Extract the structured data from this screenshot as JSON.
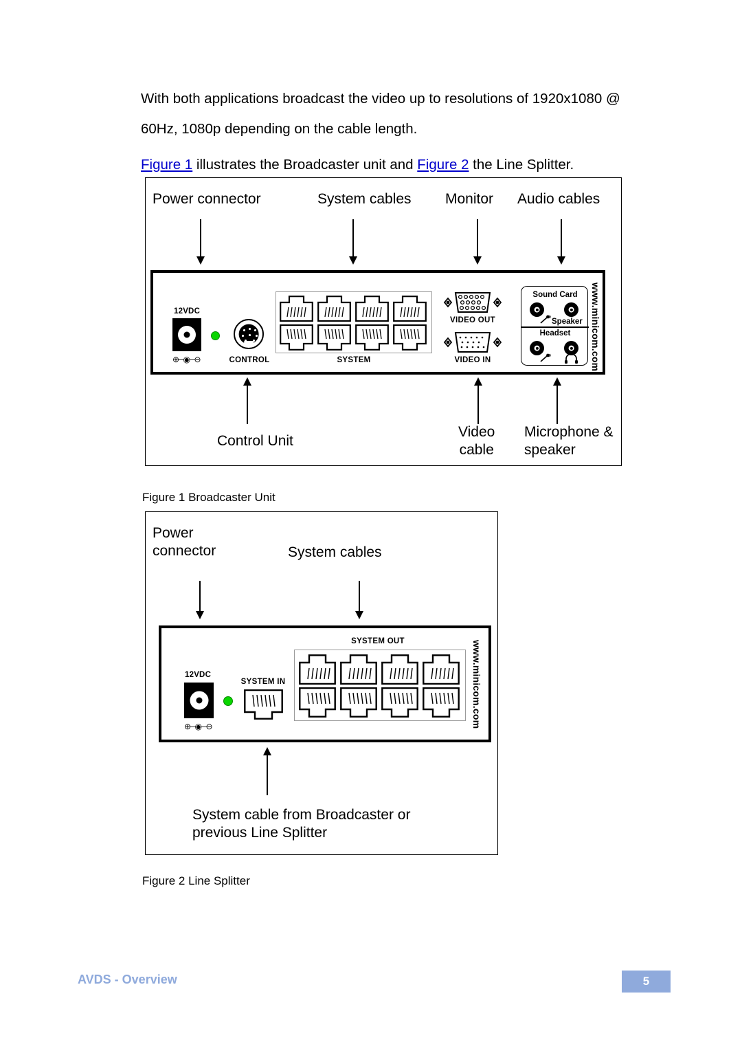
{
  "document": {
    "paragraphs": {
      "intro": "With both applications broadcast the video up to resolutions of 1920x1080 @ 60Hz, 1080p depending on the cable length.",
      "figrefs": {
        "link1": "Figure 1",
        "mid": " illustrates the Broadcaster unit and ",
        "link2": "Figure 2",
        "tail": " the Line Splitter."
      }
    }
  },
  "figure1": {
    "caption": "Figure 1 Broadcaster Unit",
    "top_callouts": [
      {
        "label": "Power connector"
      },
      {
        "label": "System cables"
      },
      {
        "label": "Monitor"
      },
      {
        "label": "Audio cables"
      }
    ],
    "bottom_callouts": [
      {
        "label": "Control Unit"
      },
      {
        "label": "Video\ncable"
      },
      {
        "label": "Microphone &\nspeaker"
      }
    ],
    "device": {
      "power_label": "12VDC",
      "polarity_symbol": "⊕─◉─⊖",
      "control_label": "CONTROL",
      "system_label": "SYSTEM",
      "system_port_count": 8,
      "video_out_label": "VIDEO OUT",
      "video_in_label": "VIDEO IN",
      "audio": {
        "sound_card_title": "Sound Card",
        "speaker_label": "Speaker",
        "headset_title": "Headset"
      },
      "brand": "www.minicom.com"
    }
  },
  "figure2": {
    "caption": "Figure 2 Line Splitter",
    "top_callouts": [
      {
        "label": "Power\nconnector"
      },
      {
        "label": "System cables"
      }
    ],
    "bottom_callouts": [
      {
        "label": "System cable from Broadcaster or\nprevious Line Splitter"
      }
    ],
    "device": {
      "power_label": "12VDC",
      "polarity_symbol": "⊕─◉─⊖",
      "system_in_label": "SYSTEM IN",
      "system_out_label": "SYSTEM OUT",
      "system_out_port_count": 8,
      "brand": "www.minicom.com"
    }
  },
  "footer": {
    "title": "AVDS - Overview",
    "page_number": "5",
    "accent_color": "#8faadc"
  }
}
